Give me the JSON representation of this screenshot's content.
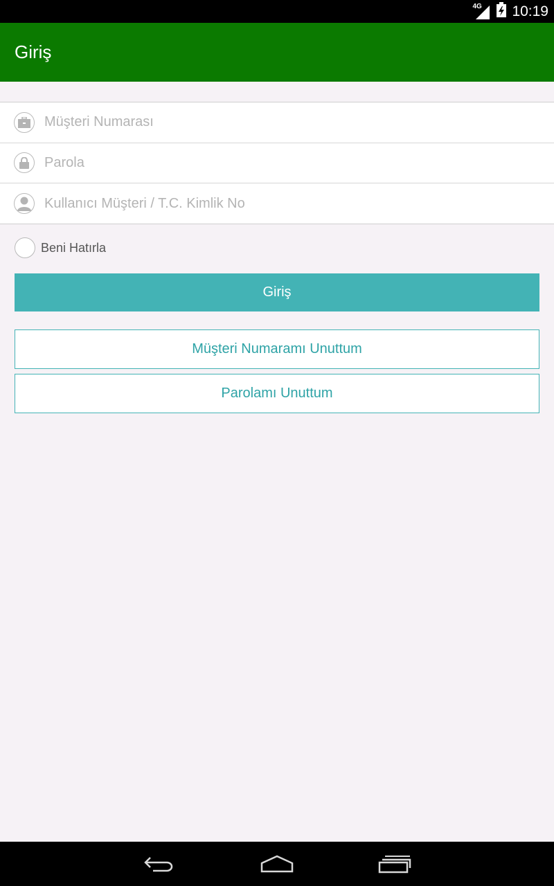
{
  "status_bar": {
    "network": "4G",
    "time": "10:19"
  },
  "app_bar": {
    "title": "Giriş"
  },
  "form": {
    "customer_number_placeholder": "Müşteri Numarası",
    "password_placeholder": "Parola",
    "user_id_placeholder": "Kullanıcı Müşteri / T.C. Kimlik No",
    "remember_label": "Beni Hatırla",
    "remember_checked": false
  },
  "buttons": {
    "login": "Giriş",
    "forgot_customer_number": "Müşteri Numaramı Unuttum",
    "forgot_password": "Parolamı Unuttum"
  },
  "colors": {
    "app_bar": "#0b7a00",
    "accent": "#43b3b5",
    "background": "#f6f2f6"
  },
  "icons": {
    "customer_number": "briefcase-icon",
    "password": "lock-icon",
    "user": "person-icon",
    "nav_back": "back-icon",
    "nav_home": "home-icon",
    "nav_recents": "recents-icon"
  }
}
